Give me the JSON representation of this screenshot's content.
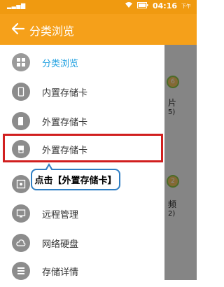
{
  "status_bar": {
    "time": "04:16",
    "ampm": "下午"
  },
  "app_bar": {
    "title": "分类浏览"
  },
  "drawer": {
    "items": [
      {
        "label": "分类浏览"
      },
      {
        "label": "内置存储卡"
      },
      {
        "label": "外置存储卡"
      },
      {
        "label": "外置存储卡"
      },
      {
        "label": ""
      },
      {
        "label": "远程管理"
      },
      {
        "label": "网络硬盘"
      },
      {
        "label": "存储详情"
      }
    ]
  },
  "callout": {
    "text": "点击【外置存储卡】"
  },
  "background_peek": {
    "badge1": "6",
    "text1": "片",
    "text1b": "5)",
    "badge2": "2",
    "text2": "频",
    "text2b": "2)"
  }
}
